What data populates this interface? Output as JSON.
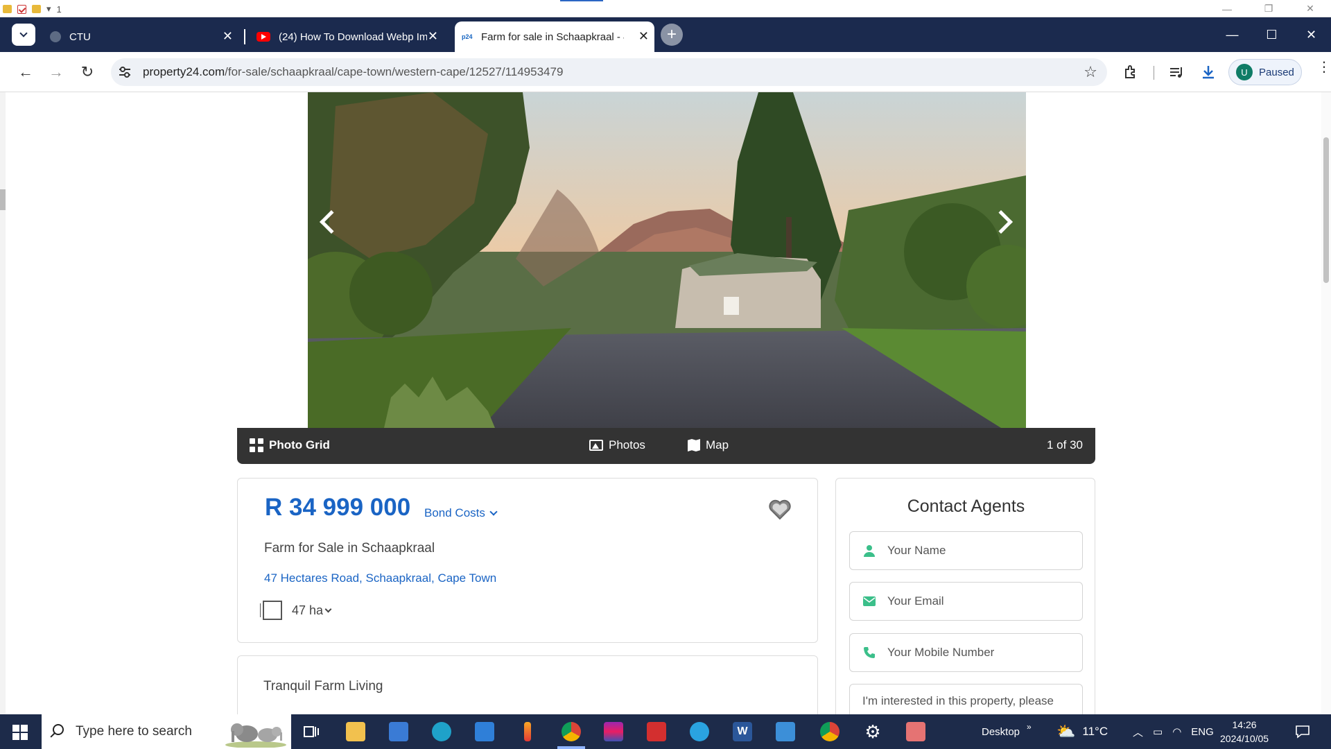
{
  "system_strip": {
    "page_indicator": "1"
  },
  "tabs": [
    {
      "label": "CTU",
      "favicon": "globe-icon",
      "active": false
    },
    {
      "label": "(24) How To Download Webp Im",
      "favicon": "youtube-icon",
      "active": false
    },
    {
      "label": "Farm for sale in Schaapkraal - 4",
      "favicon": "p24-icon",
      "active": true
    }
  ],
  "favicon_text": {
    "p24": "p24"
  },
  "address_bar": {
    "host": "property24.com",
    "path": "/for-sale/schaapkraal/cape-town/western-cape/12527/114953479"
  },
  "profile": {
    "initial": "U",
    "status": "Paused"
  },
  "gallery": {
    "grid_label": "Photo Grid",
    "photos_label": "Photos",
    "map_label": "Map",
    "counter": "1 of 30"
  },
  "listing": {
    "price": "R 34 999 000",
    "bond_costs_label": "Bond Costs",
    "title": "Farm for Sale in Schaapkraal",
    "address": {
      "street": "47 Hectares Road",
      "suburb": "Schaapkraal",
      "city": "Cape Town",
      "separator": ", "
    },
    "size": "47 ha"
  },
  "description": {
    "title": "Tranquil Farm Living"
  },
  "contact": {
    "title": "Contact Agents",
    "name_placeholder": "Your Name",
    "email_placeholder": "Your Email",
    "mobile_placeholder": "Your Mobile Number",
    "message_placeholder": "I'm interested in this property, please"
  },
  "taskbar": {
    "search_placeholder": "Type here to search",
    "desktop_label": "Desktop",
    "weather": "11°C",
    "language": "ENG",
    "time": "14:26",
    "date": "2024/10/05"
  },
  "colors": {
    "tab_bar": "#1b2a4e",
    "brand_blue": "#1a64c4",
    "contact_icon": "#3bbf8a",
    "taskbar": "#1d2b4a"
  }
}
